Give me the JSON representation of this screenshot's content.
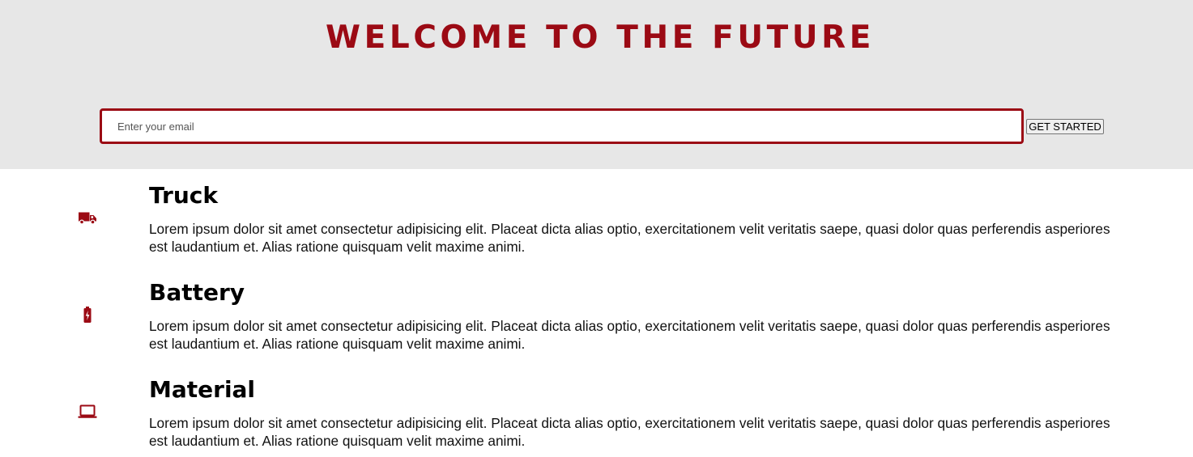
{
  "header": {
    "title": "WELCOME TO THE FUTURE",
    "accent_color": "#9b0a14",
    "background_color": "#e7e7e7"
  },
  "signup": {
    "email_placeholder": "Enter your email",
    "email_value": "",
    "submit_label": "GET STARTED"
  },
  "features": [
    {
      "icon": "truck-icon",
      "title": "Truck",
      "text": "Lorem ipsum dolor sit amet consectetur adipisicing elit. Placeat dicta alias optio, exercitationem velit veritatis saepe, quasi dolor quas perferendis asperiores est laudantium et. Alias ratione quisquam velit maxime animi."
    },
    {
      "icon": "battery-charging-icon",
      "title": "Battery",
      "text": "Lorem ipsum dolor sit amet consectetur adipisicing elit. Placeat dicta alias optio, exercitationem velit veritatis saepe, quasi dolor quas perferendis asperiores est laudantium et. Alias ratione quisquam velit maxime animi."
    },
    {
      "icon": "laptop-icon",
      "title": "Material",
      "text": "Lorem ipsum dolor sit amet consectetur adipisicing elit. Placeat dicta alias optio, exercitationem velit veritatis saepe, quasi dolor quas perferendis asperiores est laudantium et. Alias ratione quisquam velit maxime animi."
    }
  ]
}
